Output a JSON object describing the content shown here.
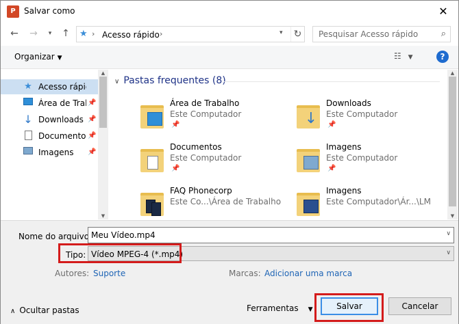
{
  "window": {
    "title": "Salvar como",
    "app_icon": "P"
  },
  "nav": {
    "address_crumb": "Acesso rápido",
    "search_placeholder": "Pesquisar Acesso rápido"
  },
  "toolbar": {
    "organize_label": "Organizar"
  },
  "sidebar": {
    "items": [
      {
        "label": "Acesso rápido",
        "icon": "star-icon",
        "selected": true
      },
      {
        "label": "Área de Trabalho",
        "icon": "desktop-icon",
        "pinned": true
      },
      {
        "label": "Downloads",
        "icon": "download-icon",
        "pinned": true
      },
      {
        "label": "Documentos",
        "icon": "document-icon",
        "pinned": true
      },
      {
        "label": "Imagens",
        "icon": "image-icon",
        "pinned": true
      }
    ]
  },
  "main": {
    "group_title": "Pastas frequentes (8)",
    "tiles": [
      {
        "name": "Área de Trabalho",
        "sub": "Este Computador"
      },
      {
        "name": "Downloads",
        "sub": "Este Computador"
      },
      {
        "name": "Documentos",
        "sub": "Este Computador"
      },
      {
        "name": "Imagens",
        "sub": "Este Computador"
      },
      {
        "name": "FAQ Phonecorp",
        "sub": "Este Co...\\Área de Trabalho"
      },
      {
        "name": "Imagens",
        "sub": "Este Computador\\Ár...\\LM"
      }
    ]
  },
  "form": {
    "filename_label": "Nome do arquivo:",
    "filename_value": "Meu Vídeo.mp4",
    "type_label": "Tipo:",
    "type_value": "Vídeo MPEG-4 (*.mp4)",
    "authors_label": "Autores:",
    "authors_value": "Suporte",
    "tags_label": "Marcas:",
    "tags_value": "Adicionar uma marca"
  },
  "footer": {
    "hide_folders": "Ocultar pastas",
    "tools": "Ferramentas",
    "save": "Salvar",
    "cancel": "Cancelar"
  },
  "colors": {
    "accent": "#1e6bcf",
    "highlight": "#d41b1b",
    "selected": "#ccdff2",
    "link": "#1e64b5"
  }
}
